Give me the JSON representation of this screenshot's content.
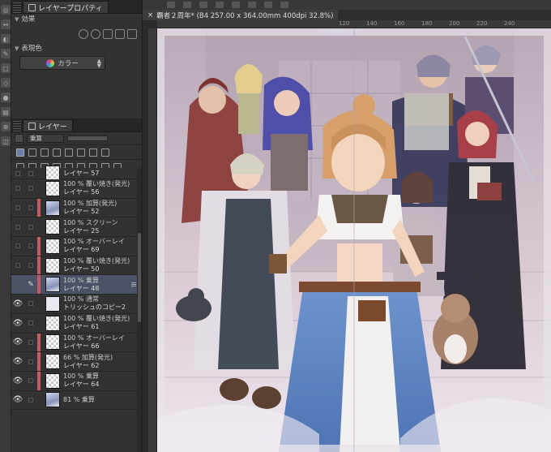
{
  "layer_property_panel": {
    "tab_label": "レイヤープロパティ",
    "effect_label": "効果",
    "expression_color_label": "表現色",
    "color_mode_value": "カラー"
  },
  "layer_panel": {
    "tab_label": "レイヤー",
    "blend_mode": "乗算",
    "layers": [
      {
        "mode": "",
        "name": "レイヤー 57",
        "clip": false,
        "eye": false,
        "thumb": "checker"
      },
      {
        "mode": "100 % 覆い焼き(発光)",
        "name": "レイヤー 56",
        "clip": false,
        "eye": false,
        "thumb": "checker"
      },
      {
        "mode": "100 % 加算(発光)",
        "name": "レイヤー 52",
        "clip": true,
        "eye": false,
        "thumb": "art"
      },
      {
        "mode": "100 % スクリーン",
        "name": "レイヤー 25",
        "clip": false,
        "eye": false,
        "thumb": "checker"
      },
      {
        "mode": "100 % オーバーレイ",
        "name": "レイヤー 69",
        "clip": true,
        "eye": false,
        "thumb": "checker"
      },
      {
        "mode": "100 % 覆い焼き(発光)",
        "name": "レイヤー 50",
        "clip": true,
        "eye": false,
        "thumb": "checker"
      },
      {
        "mode": "100 % 乗算",
        "name": "レイヤー 48",
        "clip": true,
        "eye": false,
        "thumb": "art",
        "selected": true
      },
      {
        "mode": "100 % 通常",
        "name": "トリッシュのコピー2",
        "clip": false,
        "eye": true,
        "thumb": "solid"
      },
      {
        "mode": "100 % 覆い焼き(発光)",
        "name": "レイヤー 61",
        "clip": false,
        "eye": true,
        "thumb": "checker"
      },
      {
        "mode": "100 % オーバーレイ",
        "name": "レイヤー 66",
        "clip": true,
        "eye": true,
        "thumb": "checker"
      },
      {
        "mode": "66 % 加算(発光)",
        "name": "レイヤー 62",
        "clip": true,
        "eye": true,
        "thumb": "checker"
      },
      {
        "mode": "100 % 乗算",
        "name": "レイヤー 64",
        "clip": true,
        "eye": true,
        "thumb": "checker"
      },
      {
        "mode": "81 % 乗算",
        "name": "",
        "clip": false,
        "eye": true,
        "thumb": "art"
      }
    ]
  },
  "canvas": {
    "document_tab": "覇者２周年* (B4 257.00 x 364.00mm 400dpi 32.8%)",
    "ruler_ticks": [
      "120",
      "140",
      "160",
      "180",
      "200",
      "220",
      "240"
    ]
  },
  "colors": {
    "panel_bg": "#323232",
    "selected_row": "#4d5366",
    "clip_marker": "#c45a62"
  }
}
